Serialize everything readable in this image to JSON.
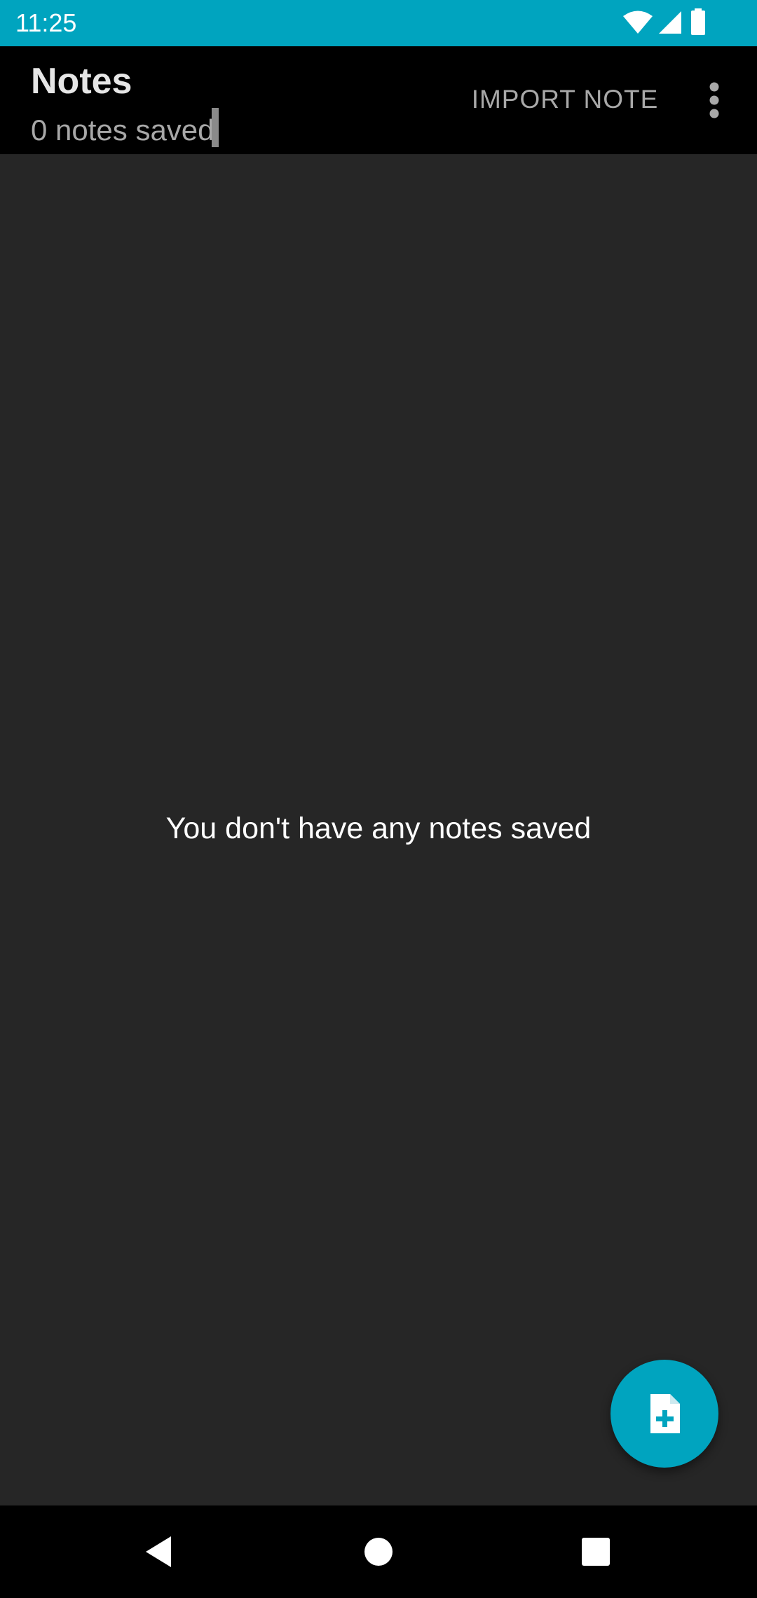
{
  "status_bar": {
    "time": "11:25",
    "icons": [
      "wifi-icon",
      "signal-icon",
      "battery-icon"
    ],
    "background": "#00a4bf"
  },
  "app_bar": {
    "title": "Notes",
    "subtitle": "0 notes saved",
    "import_label": "IMPORT NOTE",
    "overflow_icon": "more-vert-icon"
  },
  "main": {
    "empty_message": "You don't have any notes saved"
  },
  "fab": {
    "icon": "note-add-icon",
    "color": "#00a4bf"
  },
  "nav_bar": {
    "buttons": [
      "back-icon",
      "home-icon",
      "recents-icon"
    ]
  }
}
